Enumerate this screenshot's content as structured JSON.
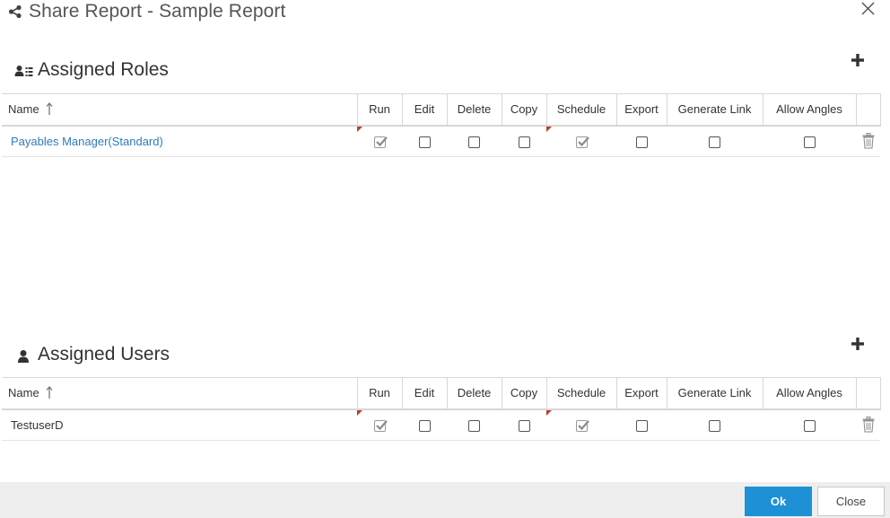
{
  "dialog": {
    "title": "Share Report - Sample Report",
    "title_icon": "share-icon",
    "close_icon": "close-icon"
  },
  "roles": {
    "section_title": "Assigned Roles",
    "section_icon": "user-group-icon",
    "add_icon": "plus-icon",
    "columns": [
      "Name",
      "Run",
      "Edit",
      "Delete",
      "Copy",
      "Schedule",
      "Export",
      "Generate Link",
      "Allow Angles"
    ],
    "sort_icon": "sort-ascending-icon",
    "rows": [
      {
        "name": "Payables Manager(Standard)",
        "run": true,
        "edit": false,
        "delete": false,
        "copy": false,
        "schedule": true,
        "export": false,
        "generate_link": false,
        "allow_angles": false,
        "delete_icon": "trash-icon"
      }
    ]
  },
  "users": {
    "section_title": "Assigned Users",
    "section_icon": "user-icon",
    "add_icon": "plus-icon",
    "columns": [
      "Name",
      "Run",
      "Edit",
      "Delete",
      "Copy",
      "Schedule",
      "Export",
      "Generate Link",
      "Allow Angles"
    ],
    "sort_icon": "sort-ascending-icon",
    "rows": [
      {
        "name": "TestuserD",
        "run": true,
        "edit": false,
        "delete": false,
        "copy": false,
        "schedule": true,
        "export": false,
        "generate_link": false,
        "allow_angles": false,
        "delete_icon": "trash-icon"
      }
    ]
  },
  "footer": {
    "ok_label": "Ok",
    "close_label": "Close"
  },
  "colors": {
    "accent": "#1e91d6",
    "link": "#2f7bbd",
    "flag": "#c0392b",
    "footer_bg": "#eeeeee"
  }
}
